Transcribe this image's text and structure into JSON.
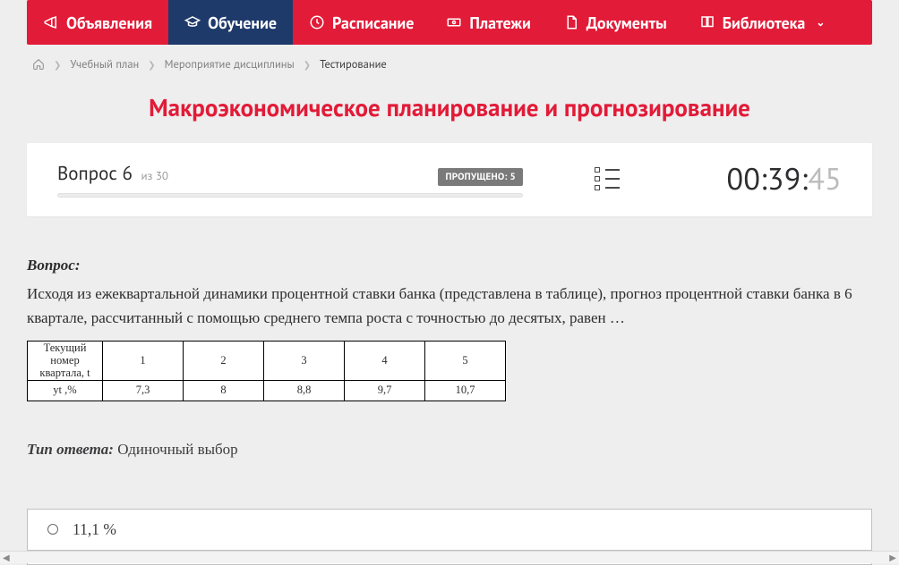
{
  "nav": {
    "items": [
      {
        "label": "Объявления"
      },
      {
        "label": "Обучение"
      },
      {
        "label": "Расписание"
      },
      {
        "label": "Платежи"
      },
      {
        "label": "Документы"
      },
      {
        "label": "Библиотека"
      }
    ]
  },
  "breadcrumbs": {
    "items": [
      "Учебный план",
      "Мероприятие дисциплины",
      "Тестирование"
    ]
  },
  "title": "Макроэкономическое планирование и прогнозирование",
  "status": {
    "question_word": "Вопрос",
    "question_num": "6",
    "of_word": "из",
    "total": "30",
    "skipped_label": "ПРОПУЩЕНО: 5"
  },
  "timer": {
    "mm": "00",
    "ss": "39",
    "cs": "45"
  },
  "question": {
    "label": "Вопрос:",
    "text": "Исходя из ежеквартальной динамики процентной ставки банка (представлена в таблице), прогноз процентной ставки банка в 6 квартале, рассчитанный с помощью среднего темпа роста с точностью до десятых, равен …",
    "table": {
      "row1": [
        "1",
        "2",
        "3",
        "4",
        "5"
      ],
      "row2": [
        "7,3",
        "8",
        "8,8",
        "9,7",
        "10,7"
      ],
      "row1_label_a": "Текущий номер",
      "row1_label_b": "квартала, t",
      "row2_label": "yt ,%"
    }
  },
  "chart_data": {
    "type": "table",
    "title": "Ежеквартальная динамика процентной ставки банка",
    "columns": [
      "Текущий номер квартала, t",
      "yt ,%"
    ],
    "rows": [
      {
        "t": 1,
        "yt": 7.3
      },
      {
        "t": 2,
        "yt": 8.0
      },
      {
        "t": 3,
        "yt": 8.8
      },
      {
        "t": 4,
        "yt": 9.7
      },
      {
        "t": 5,
        "yt": 10.7
      }
    ]
  },
  "answer_type": {
    "label": "Тип ответа:",
    "value": "Одиночный выбор"
  },
  "answers": [
    {
      "label": "11,1 %"
    }
  ]
}
